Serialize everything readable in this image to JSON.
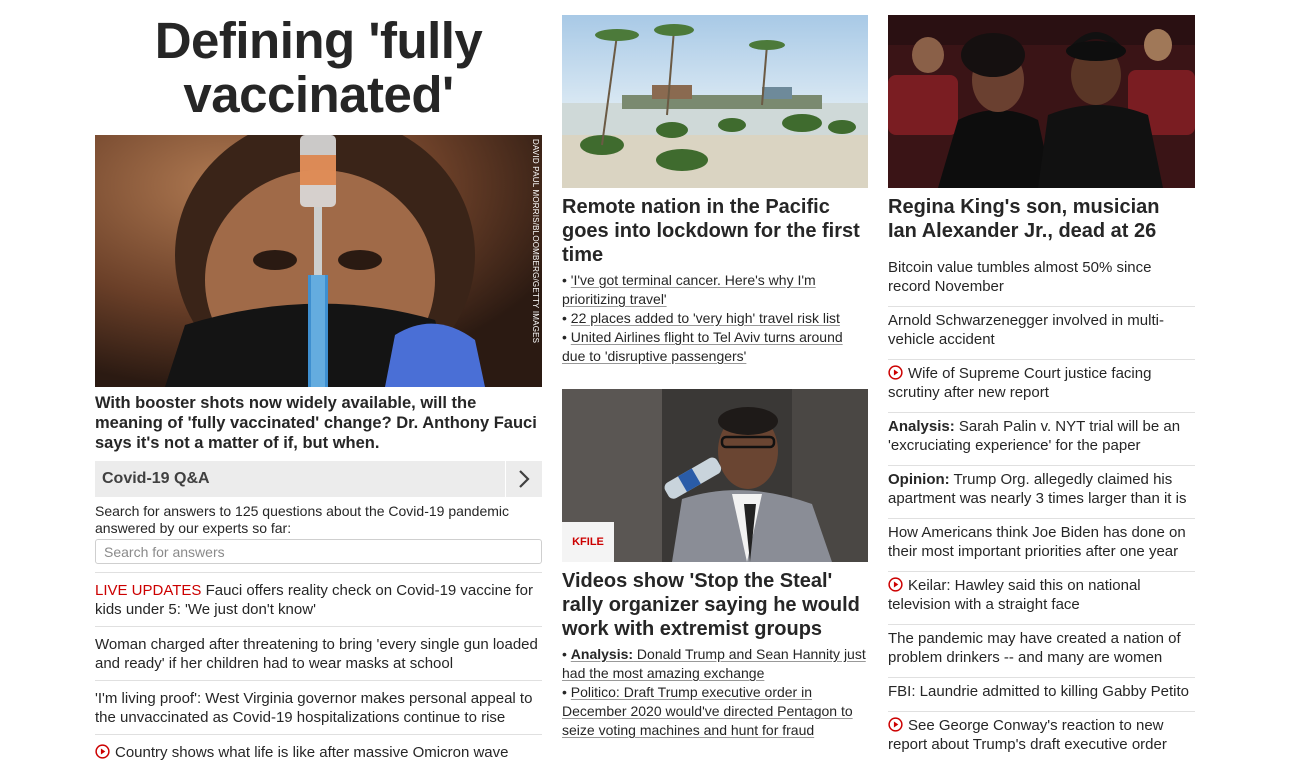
{
  "col1": {
    "hero_title": "Defining 'fully vaccinated'",
    "credit": "DAVID PAUL MORRIS/BLOOMBERG/GETTY IMAGES",
    "caption": "With booster shots now widely available, will the meaning of 'fully vaccinated' change? Dr. Anthony Fauci says it's not a matter of if, but when.",
    "qa": {
      "label": "Covid-19 Q&A",
      "description": "Search for answers to 125 questions about the Covid-19 pandemic answered by our experts so far:",
      "placeholder": "Search for answers"
    },
    "items": [
      {
        "prefix": "LIVE UPDATES",
        "text": " Fauci offers reality check on Covid-19 vaccine for kids under 5: 'We just don't know'"
      },
      {
        "text": "Woman charged after threatening to bring 'every single gun loaded and ready' if her children had to wear masks at school"
      },
      {
        "text": "'I'm living proof': West Virginia governor makes personal appeal to the unvaccinated as Covid-19 hospitalizations continue to rise"
      },
      {
        "text": "Country shows what life is like after massive Omicron wave",
        "icon": "play-icon"
      }
    ]
  },
  "col2": {
    "story1": {
      "headline": "Remote nation in the Pacific goes into lockdown for the first time",
      "links": [
        "'I've got terminal cancer. Here's why I'm prioritizing travel'",
        "22 places added to 'very high' travel risk list",
        "United Airlines flight to Tel Aviv turns around due to 'disruptive passengers'"
      ]
    },
    "story2": {
      "badge": "KFILE",
      "headline": "Videos show 'Stop the Steal' rally organizer saying he would work with extremist groups",
      "links": [
        {
          "prefix": "Analysis:",
          "text": " Donald Trump and Sean Hannity just had the most amazing exchange"
        },
        {
          "text": "Politico: Draft Trump executive order in December 2020 would've directed Pentagon to seize voting machines and hunt for fraud"
        }
      ]
    }
  },
  "col3": {
    "headline": "Regina King's son, musician Ian Alexander Jr., dead at 26",
    "items": [
      {
        "text": "Bitcoin value tumbles almost 50% since record November"
      },
      {
        "text": "Arnold Schwarzenegger involved in multi-vehicle accident"
      },
      {
        "text": "Wife of Supreme Court justice facing scrutiny after new report",
        "icon": "play-icon"
      },
      {
        "prefix": "Analysis:",
        "text": " Sarah Palin v. NYT trial will be an 'excruciating experience' for the paper"
      },
      {
        "prefix": "Opinion:",
        "text": " Trump Org. allegedly claimed his apartment was nearly 3 times larger than it is"
      },
      {
        "text": "How Americans think Joe Biden has done on their most important priorities after one year"
      },
      {
        "text": "Keilar: Hawley said this on national television with a straight face",
        "icon": "play-icon"
      },
      {
        "text": "The pandemic may have created a nation of problem drinkers -- and many are women"
      },
      {
        "text": "FBI: Laundrie admitted to killing Gabby Petito"
      },
      {
        "text": "See George Conway's reaction to new report about Trump's draft executive order",
        "icon": "play-icon"
      }
    ]
  },
  "colors": {
    "accent_red": "#cc0000",
    "text": "#262626",
    "divider": "#e0e0e0",
    "qa_bar": "#ececec"
  }
}
